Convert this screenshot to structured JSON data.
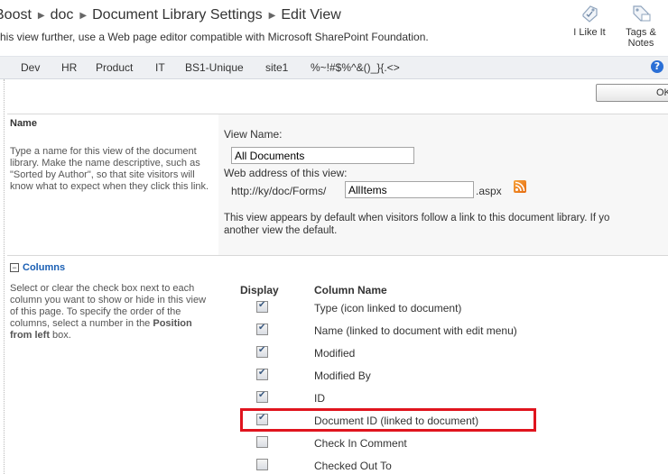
{
  "breadcrumb": {
    "site": "Boost",
    "library": "doc",
    "settings": "Document Library Settings",
    "current": "Edit View"
  },
  "page_description": "his view further, use a Web page editor compatible with Microsoft SharePoint Foundation.",
  "social": {
    "like_label": "I Like It",
    "tags_label_line1": "Tags &",
    "tags_label_line2": "Notes"
  },
  "topnav": {
    "items": [
      "Dev",
      "HR",
      "Product",
      "IT",
      "BS1-Unique",
      "site1",
      "%~!#$%^&()_}{.<>"
    ],
    "help_glyph": "?"
  },
  "ok_button": {
    "label": "OK"
  },
  "name_section": {
    "title": "Name",
    "description": "Type a name for this view of the document library. Make the name descriptive, such as \"Sorted by Author\", so that site visitors will know what to expect when they click this link.",
    "view_name_label": "View Name:",
    "view_name_value": "All Documents",
    "web_address_label": "Web address of this view:",
    "url_prefix": "http://ky/doc/Forms/",
    "url_value": "AllItems",
    "url_suffix": ".aspx",
    "default_note_line1": "This view appears by default when visitors follow a link to this document library. If yo",
    "default_note_line2": "another view the default."
  },
  "columns_section": {
    "title": "Columns",
    "collapse_glyph": "−",
    "description_part1": "Select or clear the check box next to each column you want to show or hide in this view of this page. To specify the order of the columns, select a number in the ",
    "description_bold": "Position from left",
    "description_part2": " box.",
    "header_display": "Display",
    "header_column_name": "Column Name",
    "columns": [
      {
        "name": "Type (icon linked to document)",
        "checked": true
      },
      {
        "name": "Name (linked to document with edit menu)",
        "checked": true
      },
      {
        "name": "Modified",
        "checked": true
      },
      {
        "name": "Modified By",
        "checked": true
      },
      {
        "name": "ID",
        "checked": true
      },
      {
        "name": "Document ID (linked to document)",
        "checked": true
      },
      {
        "name": "Check In Comment",
        "checked": false
      },
      {
        "name": "Checked Out To",
        "checked": false
      }
    ]
  },
  "colors": {
    "highlight": "#e0141e",
    "link_blue": "#1a5fb4",
    "nav_bar": "#eef0f3"
  }
}
